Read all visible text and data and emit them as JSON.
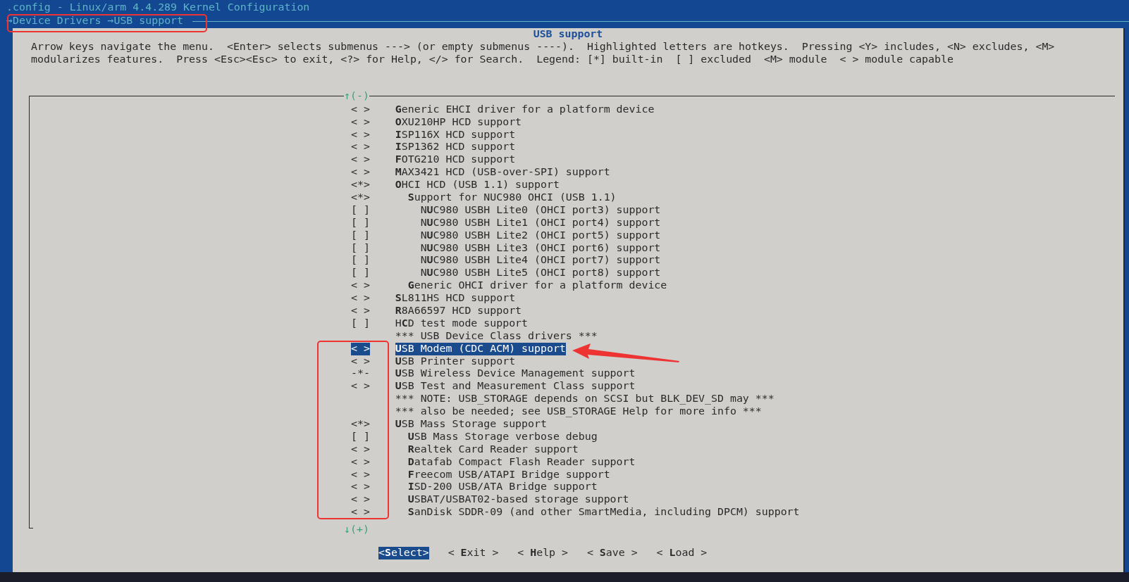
{
  "window": {
    "title": ".config - Linux/arm 4.4.289 Kernel Configuration"
  },
  "breadcrumb": [
    {
      "label": "→Device Drivers"
    },
    {
      "label": "→USB support"
    }
  ],
  "dialog": {
    "title": "USB support",
    "help": [
      "Arrow keys navigate the menu.  <Enter> selects submenus ---> (or empty submenus ----).  Highlighted letters are hotkeys.  Pressing <Y> includes, <N> excludes, <M>",
      "modularizes features.  Press <Esc><Esc> to exit, <?> for Help, </> for Search.  Legend: [*] built-in  [ ] excluded  <M> module  < > module capable"
    ]
  },
  "menu": {
    "scroll_up": "↑(-)",
    "scroll_down": "↓(+)",
    "items": [
      {
        "kind": "option",
        "state": "< >",
        "label": "**G**eneric EHCI driver for a platform device",
        "selected": false
      },
      {
        "kind": "option",
        "state": "< >",
        "label": "**O**XU210HP HCD support",
        "selected": false
      },
      {
        "kind": "option",
        "state": "< >",
        "label": "**I**SP116X HCD support",
        "selected": false
      },
      {
        "kind": "option",
        "state": "< >",
        "label": "**I**SP1362 HCD support",
        "selected": false
      },
      {
        "kind": "option",
        "state": "< >",
        "label": "**F**OTG210 HCD support",
        "selected": false
      },
      {
        "kind": "option",
        "state": "< >",
        "label": "**M**AX3421 HCD (USB-over-SPI) support",
        "selected": false
      },
      {
        "kind": "option",
        "state": "<*>",
        "label": "**O**HCI HCD (USB 1.1) support",
        "selected": false,
        "children": [
          {
            "kind": "option",
            "state": "<*>",
            "label": "**S**upport for NUC980 OHCI (USB 1.1)",
            "selected": false,
            "children": [
              {
                "kind": "option",
                "state": "[ ]",
                "label": "N**U**C980 USBH Lite0 (OHCI port3) support",
                "selected": false
              },
              {
                "kind": "option",
                "state": "[ ]",
                "label": "N**U**C980 USBH Lite1 (OHCI port4) support",
                "selected": false
              },
              {
                "kind": "option",
                "state": "[ ]",
                "label": "N**U**C980 USBH Lite2 (OHCI port5) support",
                "selected": false
              },
              {
                "kind": "option",
                "state": "[ ]",
                "label": "N**U**C980 USBH Lite3 (OHCI port6) support",
                "selected": false
              },
              {
                "kind": "option",
                "state": "[ ]",
                "label": "N**U**C980 USBH Lite4 (OHCI port7) support",
                "selected": false
              },
              {
                "kind": "option",
                "state": "[ ]",
                "label": "N**U**C980 USBH Lite5 (OHCI port8) support",
                "selected": false
              }
            ]
          },
          {
            "kind": "option",
            "state": "< >",
            "label": "**G**eneric OHCI driver for a platform device",
            "selected": false
          }
        ]
      },
      {
        "kind": "option",
        "state": "< >",
        "label": "**S**L811HS HCD support",
        "selected": false
      },
      {
        "kind": "option",
        "state": "< >",
        "label": "**R**8A66597 HCD support",
        "selected": false
      },
      {
        "kind": "option",
        "state": "[ ]",
        "label": "H**C**D test mode support",
        "selected": false
      },
      {
        "kind": "comment",
        "label": "*** USB Device Class drivers ***",
        "selected": false
      },
      {
        "kind": "option",
        "state": "< >",
        "label": "**U**SB Modem (CDC ACM) support",
        "selected": true
      },
      {
        "kind": "option",
        "state": "< >",
        "label": "**U**SB Printer support",
        "selected": false
      },
      {
        "kind": "option",
        "state": "-*-",
        "label": "**U**SB Wireless Device Management support",
        "selected": false
      },
      {
        "kind": "option",
        "state": "< >",
        "label": "**U**SB Test and Measurement Class support",
        "selected": false
      },
      {
        "kind": "comment",
        "label": "*** NOTE: USB_STORAGE depends on SCSI but BLK_DEV_SD may ***",
        "selected": false
      },
      {
        "kind": "comment",
        "label": "*** also be needed; see USB_STORAGE Help for more info ***",
        "selected": false
      },
      {
        "kind": "option",
        "state": "<*>",
        "label": "**U**SB Mass Storage support",
        "selected": false,
        "children": [
          {
            "kind": "option",
            "state": "[ ]",
            "label": "**U**SB Mass Storage verbose debug",
            "selected": false
          },
          {
            "kind": "option",
            "state": "< >",
            "label": "**R**ealtek Card Reader support",
            "selected": false
          },
          {
            "kind": "option",
            "state": "< >",
            "label": "**D**atafab Compact Flash Reader support",
            "selected": false
          },
          {
            "kind": "option",
            "state": "< >",
            "label": "**F**reecom USB/ATAPI Bridge support",
            "selected": false
          },
          {
            "kind": "option",
            "state": "< >",
            "label": "**I**SD-200 USB/ATA Bridge support",
            "selected": false
          },
          {
            "kind": "option",
            "state": "< >",
            "label": "**U**SBAT/USBAT02-based storage support",
            "selected": false
          },
          {
            "kind": "option",
            "state": "< >",
            "label": "**S**anDisk SDDR-09 (and other SmartMedia, including DPCM) support",
            "selected": false
          }
        ]
      }
    ]
  },
  "buttons": [
    {
      "label": "<**S**elect>",
      "selected": true
    },
    {
      "label": "< **E**xit >",
      "selected": false
    },
    {
      "label": "< **H**elp >",
      "selected": false
    },
    {
      "label": "< **S**ave >",
      "selected": false
    },
    {
      "label": "< **L**oad >",
      "selected": false
    }
  ],
  "annotations": [
    {
      "kind": "box"
    },
    {
      "kind": "box"
    },
    {
      "kind": "arrow"
    }
  ]
}
